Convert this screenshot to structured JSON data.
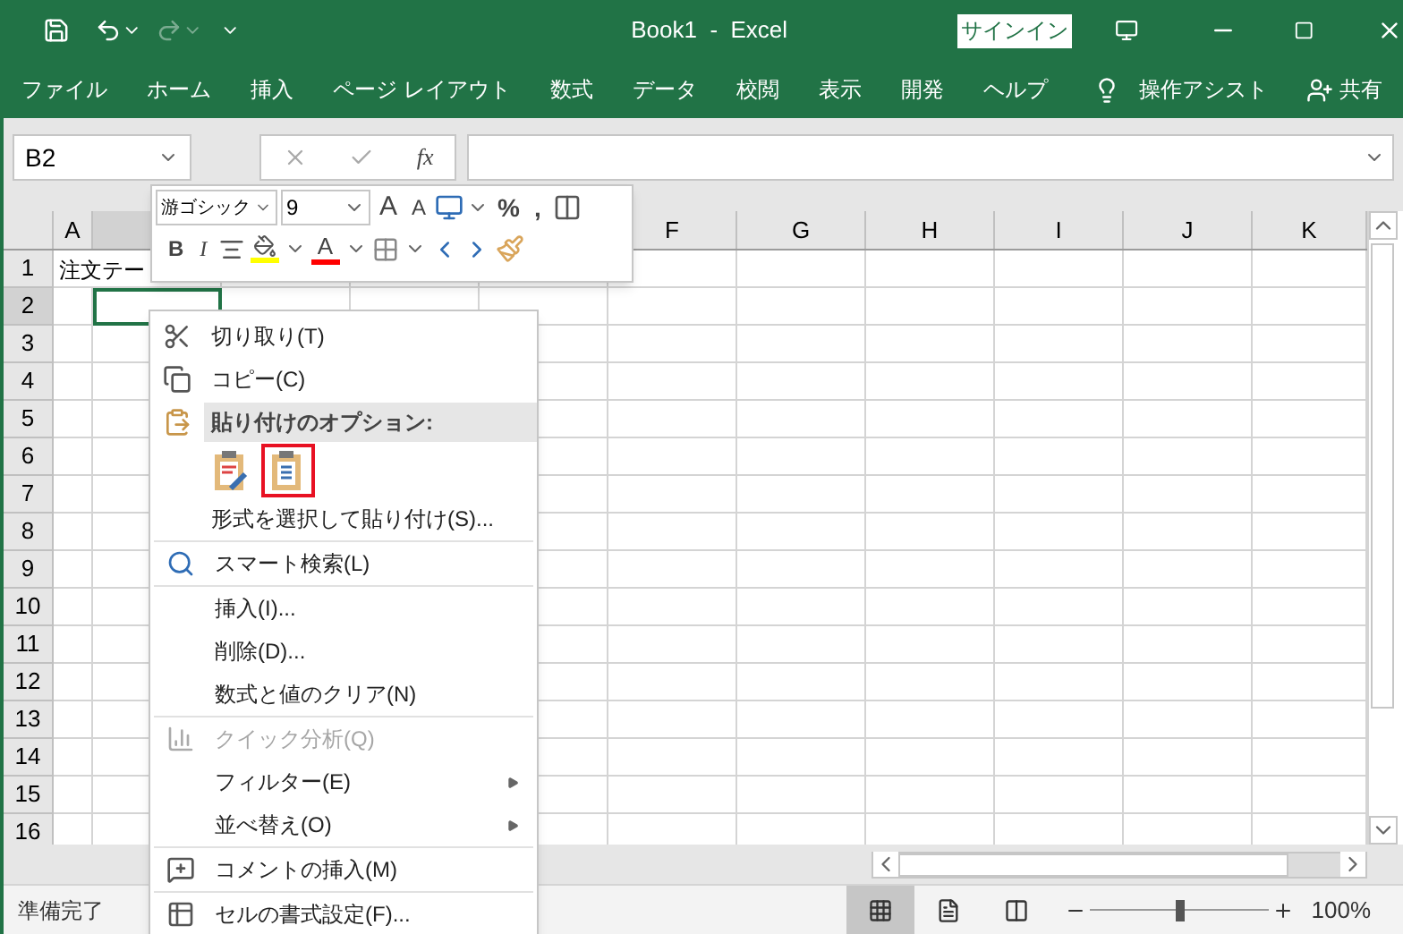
{
  "window": {
    "title": "Book1  -  Excel",
    "sign_in": "サインイン"
  },
  "ribbon_tabs": [
    {
      "label": "ファイル"
    },
    {
      "label": "ホーム"
    },
    {
      "label": "挿入"
    },
    {
      "label": "ページ レイアウト"
    },
    {
      "label": "数式"
    },
    {
      "label": "データ"
    },
    {
      "label": "校閲"
    },
    {
      "label": "表示"
    },
    {
      "label": "開発"
    },
    {
      "label": "ヘルプ"
    }
  ],
  "tell_me": "操作アシスト",
  "share": "共有",
  "formula_bar": {
    "name_box": "B2",
    "function_label": "fx"
  },
  "columns": [
    {
      "label": "A",
      "selected": false
    },
    {
      "selected": true
    },
    {
      "label": "F",
      "selected": false
    },
    {
      "label": "G",
      "selected": false
    },
    {
      "label": "H",
      "selected": false
    },
    {
      "label": "I",
      "selected": false
    },
    {
      "label": "J",
      "selected": false
    },
    {
      "label": "K",
      "selected": false
    }
  ],
  "rows": [
    {
      "label": "1",
      "selected": false,
      "cells": [
        {
          "text": "注文テー"
        }
      ]
    },
    {
      "label": "2",
      "selected": true
    },
    {
      "label": "3",
      "selected": false
    },
    {
      "label": "4",
      "selected": false
    },
    {
      "label": "5",
      "selected": false
    },
    {
      "label": "6",
      "selected": false
    },
    {
      "label": "7",
      "selected": false
    },
    {
      "label": "8",
      "selected": false
    },
    {
      "label": "9",
      "selected": false
    },
    {
      "label": "10",
      "selected": false
    },
    {
      "label": "11",
      "selected": false
    },
    {
      "label": "12",
      "selected": false
    },
    {
      "label": "13",
      "selected": false
    },
    {
      "label": "14",
      "selected": false
    },
    {
      "label": "15",
      "selected": false
    },
    {
      "label": "16",
      "selected": false
    }
  ],
  "mini_toolbar": {
    "font": "游ゴシック",
    "size": "9",
    "grow": "A",
    "shrink": "A",
    "percent": "%",
    "comma": ",",
    "bold": "B",
    "italic": "I",
    "font_color": "A"
  },
  "context_menu": {
    "sections": [
      [
        {
          "kind": "command",
          "label": "切り取り(T)",
          "disabled": false,
          "submenu": false
        },
        {
          "kind": "command",
          "label": "コピー(C)",
          "disabled": false,
          "submenu": false
        },
        {
          "kind": "header",
          "label": "貼り付けのオプション:"
        },
        {
          "kind": "paste_options",
          "options": [
            {
              "selected": false
            },
            {
              "selected": true
            }
          ]
        },
        {
          "kind": "command",
          "label": "形式を選択して貼り付け(S)...",
          "disabled": false,
          "submenu": false
        }
      ],
      [
        {
          "kind": "command",
          "label": "スマート検索(L)",
          "disabled": false,
          "submenu": false
        }
      ],
      [
        {
          "kind": "command",
          "label": "挿入(I)...",
          "disabled": false,
          "submenu": false
        },
        {
          "kind": "command",
          "label": "削除(D)...",
          "disabled": false,
          "submenu": false
        },
        {
          "kind": "command",
          "label": "数式と値のクリア(N)",
          "disabled": false,
          "submenu": false
        }
      ],
      [
        {
          "kind": "command",
          "label": "クイック分析(Q)",
          "disabled": true,
          "submenu": false
        },
        {
          "kind": "command",
          "label": "フィルター(E)",
          "disabled": false,
          "submenu": true
        },
        {
          "kind": "command",
          "label": "並べ替え(O)",
          "disabled": false,
          "submenu": true
        }
      ],
      [
        {
          "kind": "command",
          "label": "コメントの挿入(M)",
          "disabled": false,
          "submenu": false
        }
      ],
      [
        {
          "kind": "command",
          "label": "セルの書式設定(F)...",
          "disabled": false,
          "submenu": false
        }
      ]
    ]
  },
  "status_bar": {
    "text": "準備完了",
    "zoom": "100%",
    "zoom_level": {
      "level": 0.5
    }
  }
}
